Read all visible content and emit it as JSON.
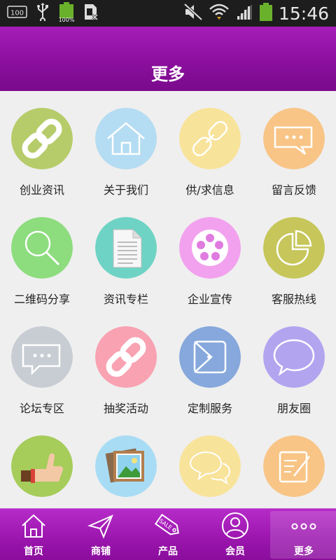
{
  "status_bar": {
    "left_icons": [
      "sd-card-icon",
      "usb-icon",
      "battery-full-icon",
      "sim-blocked-icon"
    ],
    "battery_small_text": "100",
    "battery_percent_text": "100%",
    "right_icons": [
      "mute-icon",
      "wifi-icon",
      "signal-icon",
      "battery-icon"
    ],
    "time": "15:46"
  },
  "header": {
    "title": "更多"
  },
  "grid": {
    "items": [
      {
        "label": "创业资讯",
        "icon": "link-icon",
        "color": "#b6cc6a"
      },
      {
        "label": "关于我们",
        "icon": "home-icon",
        "color": "#b4dcf2"
      },
      {
        "label": "供/求信息",
        "icon": "broken-link-icon",
        "color": "#f8e39a"
      },
      {
        "label": "留言反馈",
        "icon": "message-box-icon",
        "color": "#f8c587"
      },
      {
        "label": "二维码分享",
        "icon": "magnifier-icon",
        "color": "#8ddc7e"
      },
      {
        "label": "资讯专栏",
        "icon": "document-icon",
        "color": "#6ed3c4"
      },
      {
        "label": "企业宣传",
        "icon": "film-reel-icon",
        "color": "#f2a1ee"
      },
      {
        "label": "客服热线",
        "icon": "pie-chart-icon",
        "color": "#c6c65a"
      },
      {
        "label": "论坛专区",
        "icon": "chat-dots-icon",
        "color": "#c8cdd4"
      },
      {
        "label": "抽奖活动",
        "icon": "link-icon",
        "color": "#f8a2b2"
      },
      {
        "label": "定制服务",
        "icon": "wallet-icon",
        "color": "#86a8dc"
      },
      {
        "label": "朋友圈",
        "icon": "speech-bubble-icon",
        "color": "#b3a4f0"
      },
      {
        "label": "",
        "icon": "thumbs-up-icon",
        "color": "#a6cc5a"
      },
      {
        "label": "",
        "icon": "photos-icon",
        "color": "#a8dcf5"
      },
      {
        "label": "",
        "icon": "chat-bubbles-icon",
        "color": "#f8e39a"
      },
      {
        "label": "",
        "icon": "edit-note-icon",
        "color": "#f8c587"
      }
    ]
  },
  "bottom_nav": {
    "items": [
      {
        "label": "首页",
        "icon": "home-outline-icon",
        "active": false
      },
      {
        "label": "商铺",
        "icon": "send-icon",
        "active": false
      },
      {
        "label": "产品",
        "icon": "sale-tag-icon",
        "active": false
      },
      {
        "label": "会员",
        "icon": "user-icon",
        "active": false
      },
      {
        "label": "更多",
        "icon": "more-dots-icon",
        "active": true
      }
    ],
    "label_color": "#ffffff"
  },
  "colors": {
    "header": "#8b0f9e",
    "nav": "#9a15ad",
    "background": "#efefef"
  }
}
